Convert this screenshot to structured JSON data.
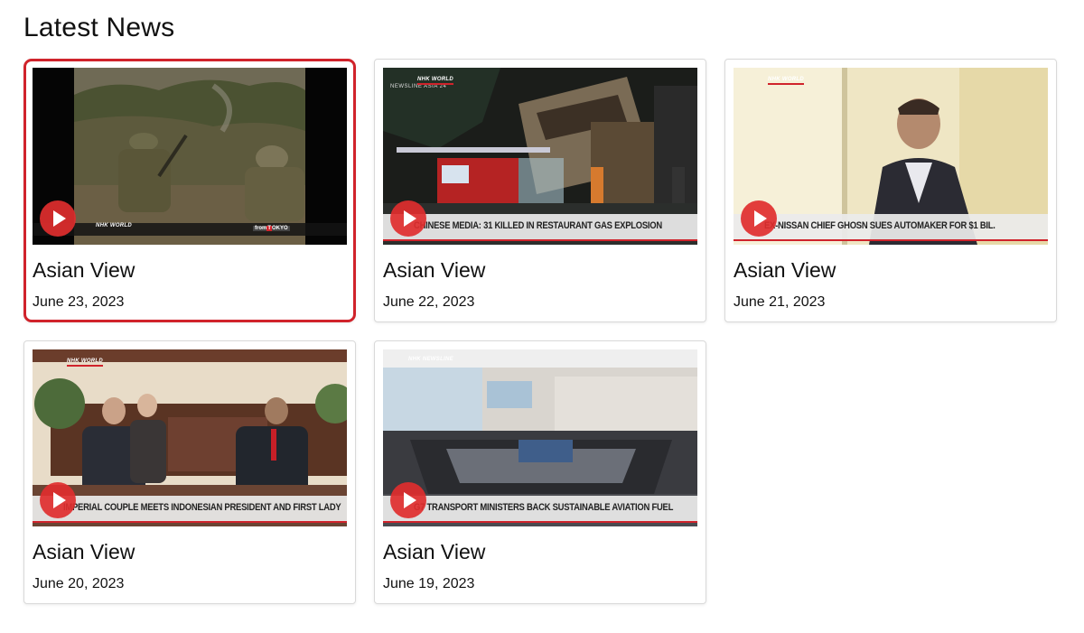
{
  "section": {
    "title": "Latest News"
  },
  "colors": {
    "accent": "#d0232b",
    "play": "#e02e2e"
  },
  "cards": [
    {
      "title": "Asian View",
      "date": "June 23, 2023",
      "caption": "",
      "logo": "NHK WORLD",
      "tag_prefix": "from",
      "tag_highlight": "T",
      "tag_suffix": "OKYO",
      "selected": true
    },
    {
      "title": "Asian View",
      "date": "June 22, 2023",
      "caption": "CHINESE MEDIA: 31 KILLED IN RESTAURANT GAS EXPLOSION",
      "logo": "NHK WORLD",
      "overlay": "NEWSLINE ASIA 24",
      "selected": false
    },
    {
      "title": "Asian View",
      "date": "June 21, 2023",
      "caption": "EX-NISSAN CHIEF GHOSN SUES AUTOMAKER FOR $1 BIL.",
      "logo": "NHK WORLD",
      "selected": false
    },
    {
      "title": "Asian View",
      "date": "June 20, 2023",
      "caption": "IMPERIAL COUPLE MEETS INDONESIAN PRESIDENT AND FIRST LADY",
      "logo": "NHK WORLD",
      "selected": false
    },
    {
      "title": "Asian View",
      "date": "June 19, 2023",
      "caption": "G7 TRANSPORT MINISTERS BACK SUSTAINABLE AVIATION FUEL",
      "logo": "NHK NEWSLINE",
      "selected": false
    }
  ]
}
